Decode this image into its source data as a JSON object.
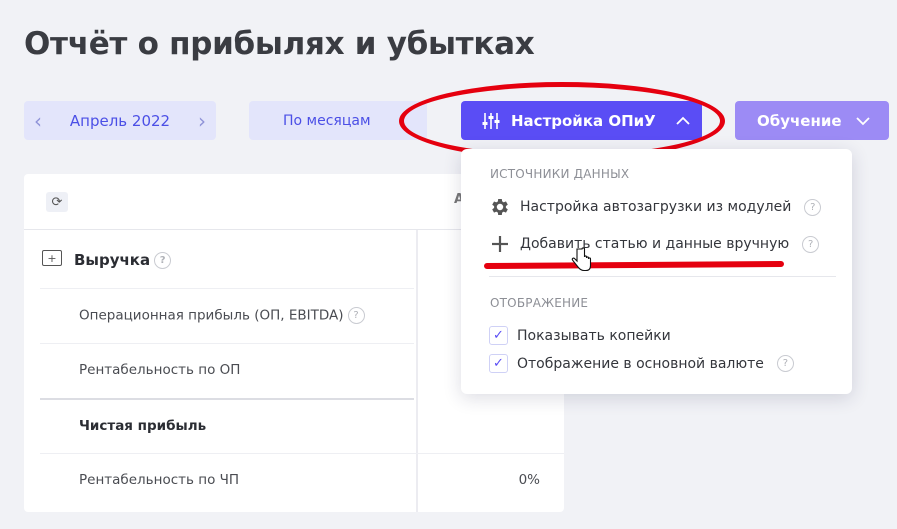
{
  "page": {
    "title": "Отчёт о прибылях и убытках"
  },
  "toolbar": {
    "month": "Апрель 2022",
    "prev_icon": "chevron-left-icon",
    "next_icon": "chevron-right-icon",
    "period": "По месяцам",
    "settings_label": "Настройка ОПиУ",
    "settings_icon": "sliders-icon",
    "learn_label": "Обучение"
  },
  "table": {
    "column_header": "А",
    "revenue_label": "Выручка",
    "rows": [
      {
        "label": "Операционная прибыль (ОП, EBITDA)",
        "value": "",
        "help": true
      },
      {
        "label": "Рентабельность по ОП",
        "value": ""
      },
      {
        "label": "Чистая прибыль",
        "value": ""
      },
      {
        "label": "Рентабельность по ЧП",
        "value": "0%"
      }
    ]
  },
  "dropdown": {
    "section_sources": "ИСТОЧНИКИ ДАННЫХ",
    "item_autoload": "Настройка автозагрузки из модулей",
    "item_manual": "Добавить статью и данные вручную",
    "section_display": "ОТОБРАЖЕНИЕ",
    "option_kopecks": "Показывать копейки",
    "option_main_currency": "Отображение в основной валюте",
    "option_kopecks_checked": true,
    "option_main_currency_checked": true
  },
  "colors": {
    "accent": "#5a4df5",
    "annotation": "#e5000f"
  },
  "help_glyph": "?"
}
